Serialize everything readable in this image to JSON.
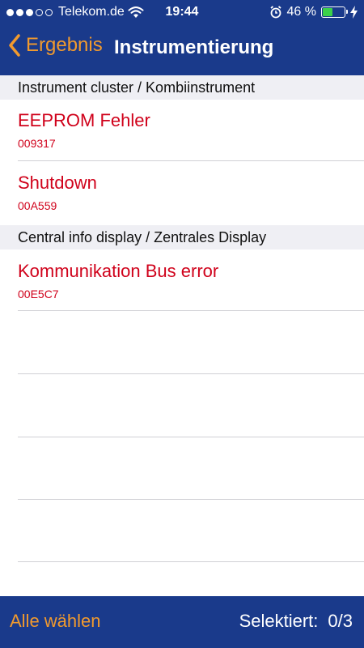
{
  "status_bar": {
    "carrier": "Telekom.de",
    "time": "19:44",
    "battery_percent": "46 %",
    "battery_level": 0.46,
    "signal_filled": 3,
    "signal_total": 5
  },
  "nav": {
    "back_label": "Ergebnis",
    "title": "Instrumentierung"
  },
  "sections": [
    {
      "header": "Instrument cluster / Kombiinstrument",
      "items": [
        {
          "title": "EEPROM Fehler",
          "code": "009317"
        },
        {
          "title": "Shutdown",
          "code": "00A559"
        }
      ]
    },
    {
      "header": "Central info display / Zentrales Display",
      "items": [
        {
          "title": "Kommunikation Bus error",
          "code": "00E5C7"
        }
      ]
    }
  ],
  "bottom_bar": {
    "select_all_label": "Alle wählen",
    "selected_label": "Selektiert:",
    "selected_value": "0/3"
  },
  "colors": {
    "bar_background": "#1a3a8b",
    "accent": "#f19a2e",
    "error_text": "#d0021b",
    "battery_fill": "#3bd14a"
  }
}
